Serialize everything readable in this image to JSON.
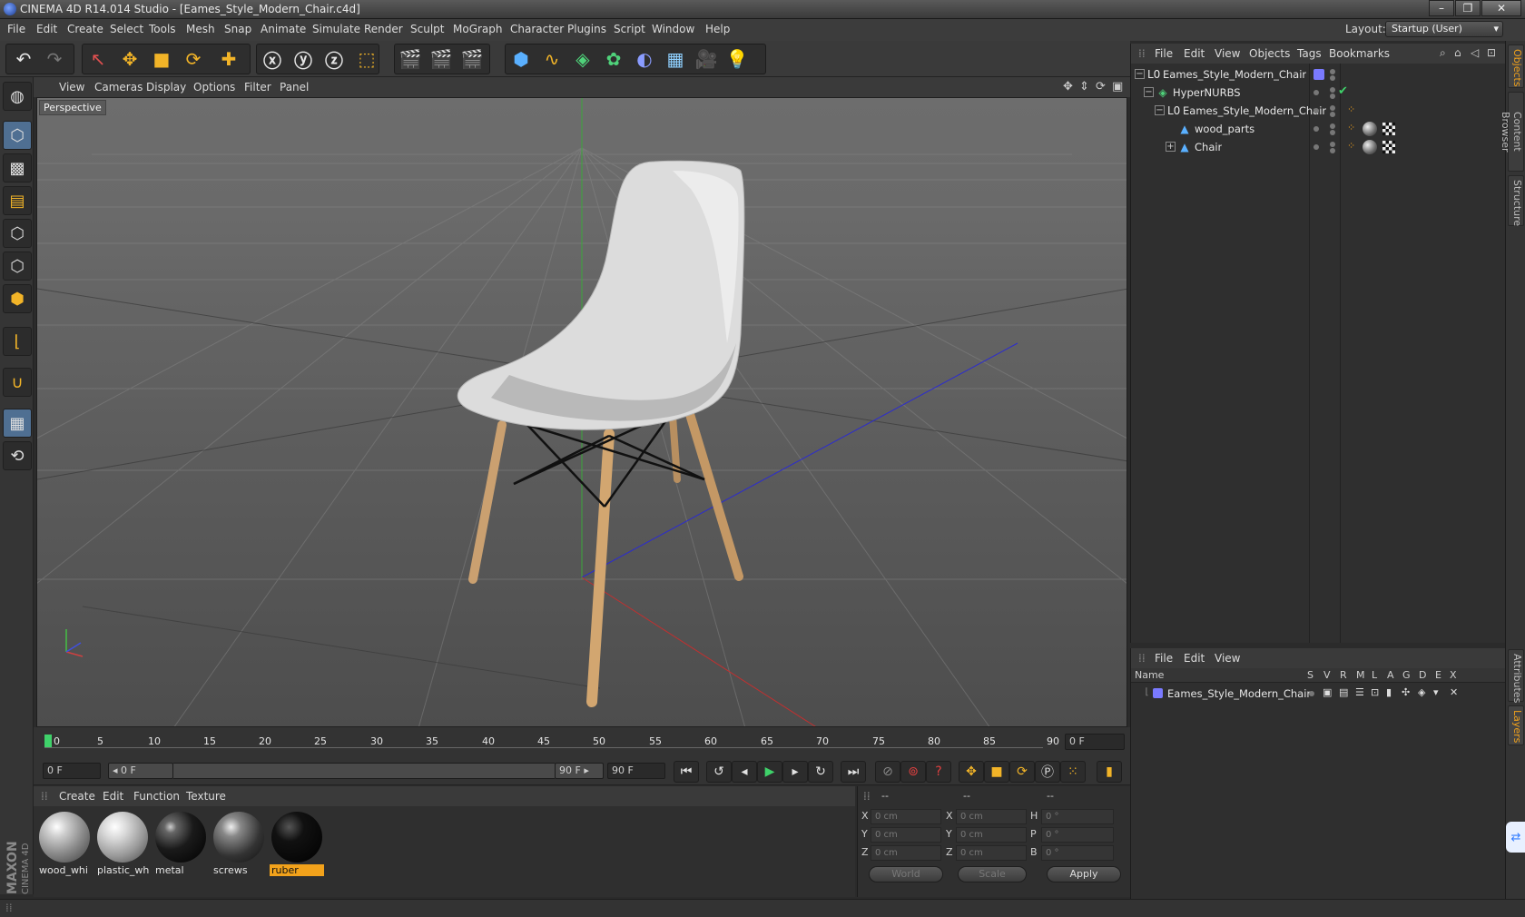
{
  "window": {
    "title": "CINEMA 4D R14.014 Studio - [Eames_Style_Modern_Chair.c4d]",
    "minimize": "–",
    "restore": "❐",
    "close": "✕"
  },
  "menubar": {
    "items": [
      "File",
      "Edit",
      "Create",
      "Select",
      "Tools",
      "Mesh",
      "Snap",
      "Animate",
      "Simulate",
      "Render",
      "Sculpt",
      "MoGraph",
      "Character",
      "Plugins",
      "Script",
      "Window",
      "Help"
    ],
    "layout_label": "Layout:",
    "layout_value": "Startup (User)"
  },
  "viewport": {
    "menu": [
      "View",
      "Cameras",
      "Display",
      "Options",
      "Filter",
      "Panel"
    ],
    "label": "Perspective"
  },
  "timeline": {
    "ticks": [
      "0",
      "5",
      "10",
      "15",
      "20",
      "25",
      "30",
      "35",
      "40",
      "45",
      "50",
      "55",
      "60",
      "65",
      "70",
      "75",
      "80",
      "85",
      "90"
    ],
    "current_frame": "0 F",
    "start_field": "0 F",
    "range_start": "◂ 0 F",
    "range_end": "90 F ▸",
    "end_field": "90 F"
  },
  "materials": {
    "menu": [
      "Create",
      "Edit",
      "Function",
      "Texture"
    ],
    "items": [
      {
        "name": "wood_whi",
        "selected": false
      },
      {
        "name": "plastic_whi",
        "selected": false
      },
      {
        "name": "metal",
        "selected": false
      },
      {
        "name": "screws",
        "selected": false
      },
      {
        "name": "ruber",
        "selected": true
      }
    ]
  },
  "coordinates": {
    "headers": [
      "--",
      "--",
      "--"
    ],
    "rows": [
      {
        "a": "X",
        "v1": "0 cm",
        "b": "X",
        "v2": "0 cm",
        "c": "H",
        "v3": "0 °"
      },
      {
        "a": "Y",
        "v1": "0 cm",
        "b": "Y",
        "v2": "0 cm",
        "c": "P",
        "v3": "0 °"
      },
      {
        "a": "Z",
        "v1": "0 cm",
        "b": "Z",
        "v2": "0 cm",
        "c": "B",
        "v3": "0 °"
      }
    ],
    "space": "World",
    "mode": "Scale",
    "apply": "Apply"
  },
  "object_manager": {
    "menu": [
      "File",
      "Edit",
      "View",
      "Objects",
      "Tags",
      "Bookmarks"
    ],
    "rows": [
      {
        "name": "Eames_Style_Modern_Chair",
        "indent": 0
      },
      {
        "name": "HyperNURBS",
        "indent": 1
      },
      {
        "name": "Eames_Style_Modern_Chair",
        "indent": 2
      },
      {
        "name": "wood_parts",
        "indent": 3
      },
      {
        "name": "Chair",
        "indent": 3
      }
    ]
  },
  "layer_manager": {
    "menu": [
      "File",
      "Edit",
      "View"
    ],
    "columns": [
      "Name",
      "S",
      "V",
      "R",
      "M",
      "L",
      "A",
      "G",
      "D",
      "E",
      "X"
    ],
    "rows": [
      {
        "name": "Eames_Style_Modern_Chair"
      }
    ]
  },
  "side_tabs": [
    "Objects",
    "Content Browser",
    "Structure",
    "Attributes",
    "Layers"
  ],
  "brand": {
    "line1": "MAXON",
    "line2": "CINEMA 4D"
  }
}
